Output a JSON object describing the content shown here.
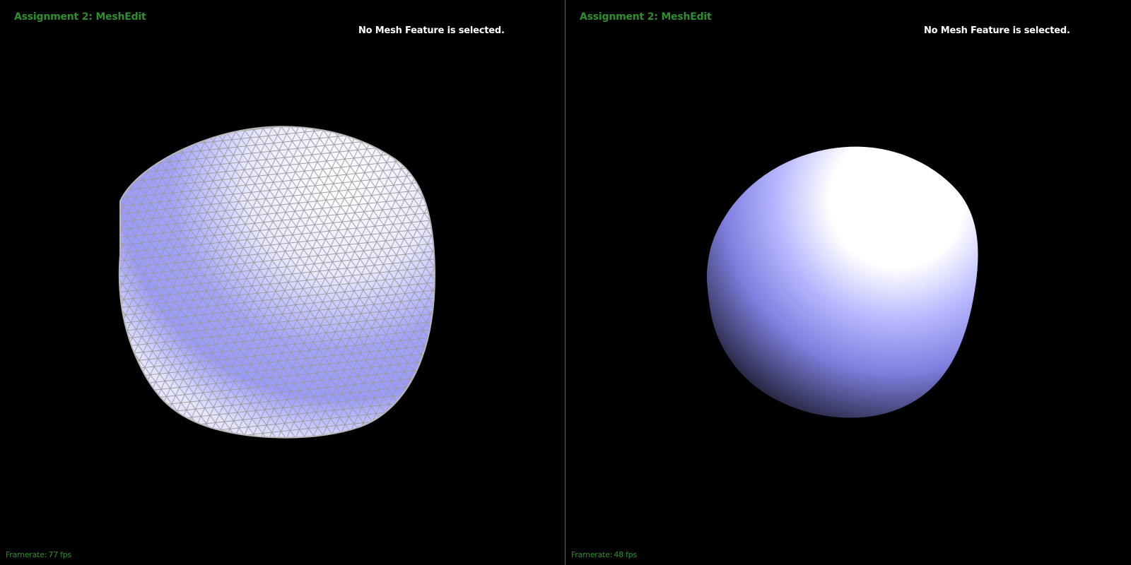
{
  "app": {
    "title": "Assignment 2: MeshEdit"
  },
  "viewports": [
    {
      "title": "Assignment 2: MeshEdit",
      "status": "No Mesh Feature is selected.",
      "framerate_label": "Framerate:",
      "framerate_value": "77",
      "framerate_unit": "fps",
      "render_mode": "wireframe-shaded"
    },
    {
      "title": "Assignment 2: MeshEdit",
      "status": "No Mesh Feature is selected.",
      "framerate_label": "Framerate:",
      "framerate_value": "48",
      "framerate_unit": "fps",
      "render_mode": "smooth-shaded"
    }
  ],
  "colors": {
    "background": "#000000",
    "title_green": "#2f8f2f",
    "status_white": "#ffffff",
    "mesh_light": "#ffffff",
    "mesh_blue": "#8a8aff",
    "wire_gray": "#9a9a9a",
    "divider": "#3f6f86"
  },
  "icons": []
}
